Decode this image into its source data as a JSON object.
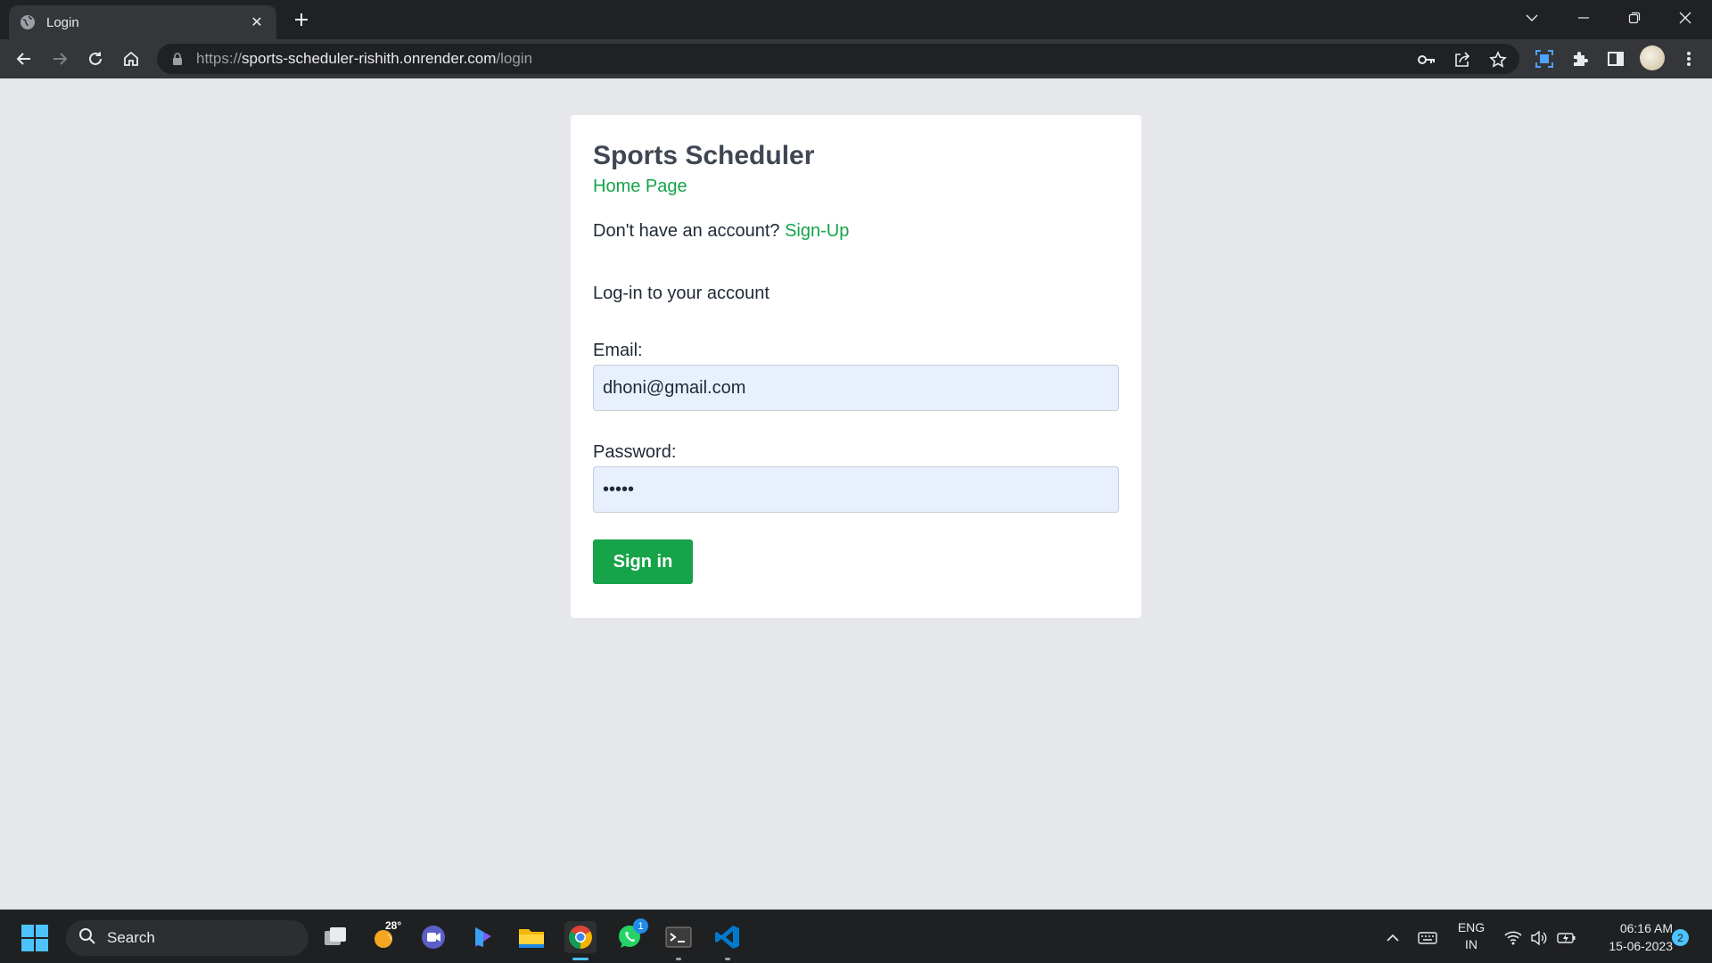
{
  "browser": {
    "tab": {
      "title": "Login",
      "favicon": "globe-icon",
      "close": "✕"
    },
    "new_tab": "new-tab-icon",
    "url": {
      "scheme": "https://",
      "host": "sports-scheduler-rishith.onrender.com",
      "path": "/login"
    },
    "toolbar_icons": [
      "back-icon",
      "forward-icon",
      "reload-icon",
      "home-icon",
      "key-icon",
      "share-icon",
      "star-icon",
      "screenshot-icon",
      "extensions-icon",
      "side-panel-icon",
      "avatar",
      "menu-icon"
    ],
    "window_controls": [
      "tab-search-icon",
      "minimize-icon",
      "restore-icon",
      "close-icon"
    ]
  },
  "page": {
    "app_title": "Sports Scheduler",
    "home_link": "Home Page",
    "signup_prompt": "Don't have an account?",
    "signup_link": "Sign-Up",
    "login_heading": "Log-in to your account",
    "email_label": "Email:",
    "email_value": "dhoni@gmail.com",
    "password_label": "Password:",
    "password_value": "•••••",
    "signin_button": "Sign in",
    "colors": {
      "accent": "#16a34a",
      "background": "#e5e7eb",
      "input_bg": "#e8f0fe"
    }
  },
  "taskbar": {
    "search_label": "Search",
    "weather_temp": "28°",
    "whatsapp_badge": "1",
    "apps": [
      "task-view-icon",
      "weather-icon",
      "teams-icon",
      "copilot-icon",
      "file-explorer-icon",
      "chrome-icon",
      "whatsapp-icon",
      "terminal-icon",
      "vscode-icon"
    ],
    "tray_icons": [
      "chevron-up-icon",
      "keyboard-icon",
      "wifi-icon",
      "volume-icon",
      "battery-icon"
    ],
    "lang_line1": "ENG",
    "lang_line2": "IN",
    "time": "06:16 AM",
    "date": "15-06-2023",
    "notification_count": "2"
  }
}
